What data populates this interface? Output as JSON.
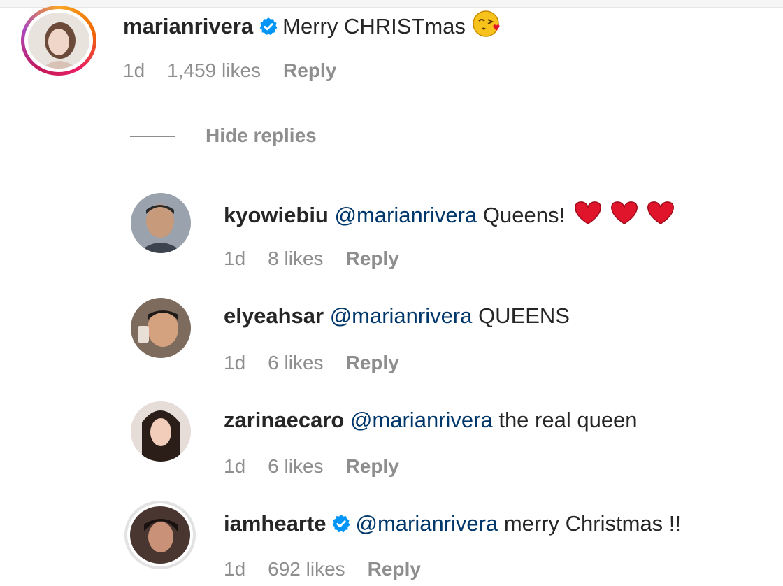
{
  "main_comment": {
    "username": "marianrivera",
    "verified": true,
    "text": "Merry CHRISTmas",
    "emoji": "kissing-face-emoji",
    "time": "1d",
    "likes": "1,459 likes",
    "reply_label": "Reply"
  },
  "hide_replies_label": "Hide replies",
  "replies": [
    {
      "username": "kyowiebiu",
      "verified": false,
      "mention": "@marianrivera",
      "text": "Queens!",
      "emoji": "three-red-hearts",
      "time": "1d",
      "likes": "8 likes",
      "reply_label": "Reply"
    },
    {
      "username": "elyeahsar",
      "verified": false,
      "mention": "@marianrivera",
      "text": "QUEENS",
      "time": "1d",
      "likes": "6 likes",
      "reply_label": "Reply"
    },
    {
      "username": "zarinaecaro",
      "verified": false,
      "mention": "@marianrivera",
      "text": "the real queen",
      "time": "1d",
      "likes": "6 likes",
      "reply_label": "Reply"
    },
    {
      "username": "iamhearte",
      "verified": true,
      "mention": "@marianrivera",
      "text": "merry Christmas !!",
      "time": "1d",
      "likes": "692 likes",
      "reply_label": "Reply"
    }
  ],
  "colors": {
    "text": "#262626",
    "secondary": "#8e8e8e",
    "mention": "#00376b",
    "verified": "#0095f6",
    "heart": "#e0142a"
  }
}
